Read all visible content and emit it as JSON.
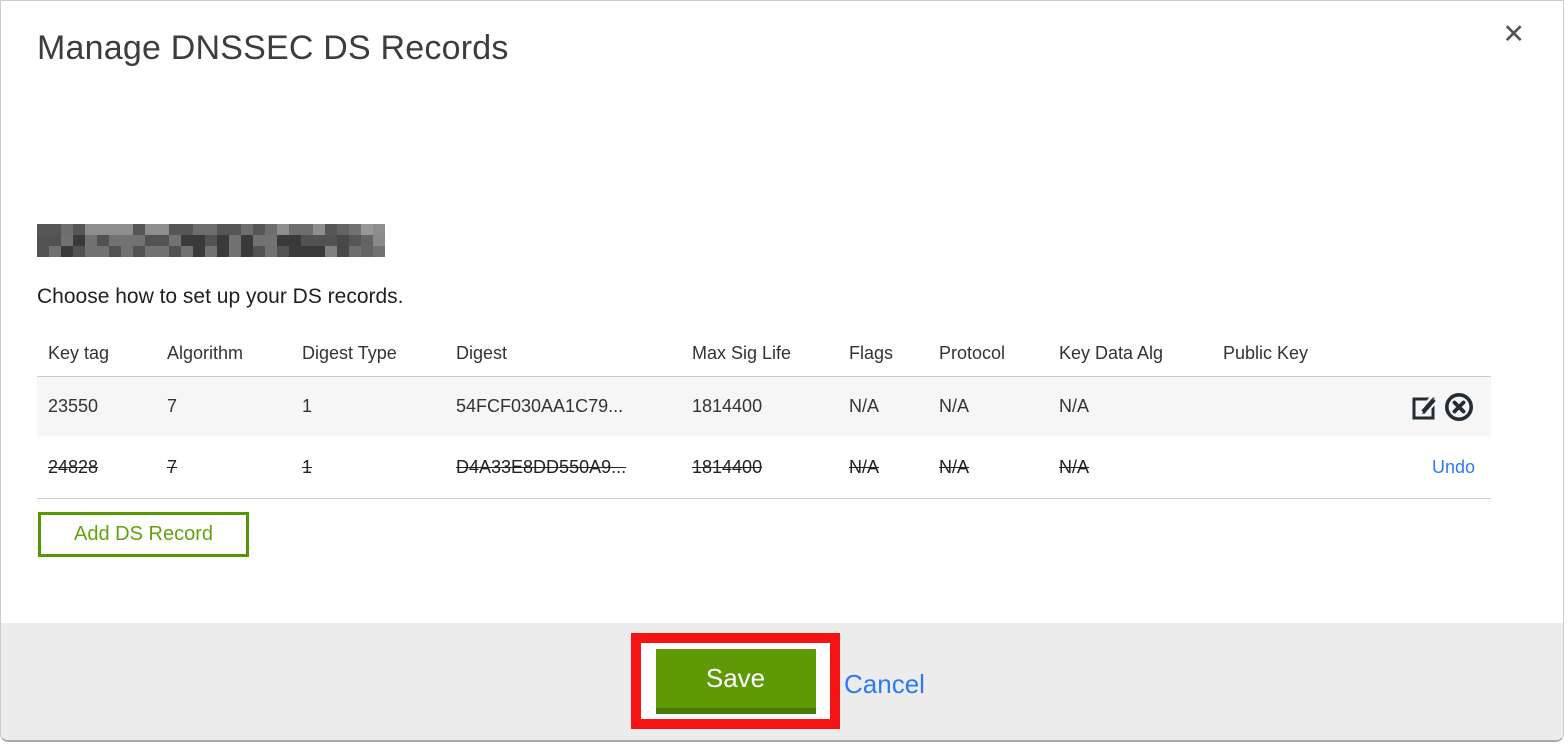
{
  "modal": {
    "title": "Manage DNSSEC DS Records",
    "close_glyph": "✕",
    "redacted_domain_note": "domain name redacted (pixelated)",
    "instruction": "Choose how to set up your DS records.",
    "table": {
      "headers": [
        "Key tag",
        "Algorithm",
        "Digest Type",
        "Digest",
        "Max Sig Life",
        "Flags",
        "Protocol",
        "Key Data Alg",
        "Public Key"
      ],
      "rows": [
        {
          "key_tag": "23550",
          "algorithm": "7",
          "digest_type": "1",
          "digest": "54FCF030AA1C79...",
          "max_sig_life": "1814400",
          "flags": "N/A",
          "protocol": "N/A",
          "key_data_alg": "N/A",
          "public_key": "",
          "state": "normal",
          "action_icons": [
            "edit-square-icon",
            "circle-x-delete-icon"
          ]
        },
        {
          "key_tag": "24828",
          "algorithm": "7",
          "digest_type": "1",
          "digest": "D4A33E8DD550A9...",
          "max_sig_life": "1814400",
          "flags": "N/A",
          "protocol": "N/A",
          "key_data_alg": "N/A",
          "public_key": "",
          "state": "deleted-strikethrough",
          "undo_label": "Undo"
        }
      ]
    },
    "add_button_label": "Add DS Record",
    "footer": {
      "save_label": "Save",
      "cancel_label": "Cancel",
      "annotation": "red highlight box around Save button"
    }
  },
  "colors": {
    "button_green": "#5d9a05",
    "button_green_dark": "#4a7c04",
    "outline_green": "#559700",
    "link_blue": "#2d7bf4",
    "annotation_red": "#f41414",
    "row_alt_bg": "#f6f6f6",
    "footer_bg": "#ececec"
  }
}
